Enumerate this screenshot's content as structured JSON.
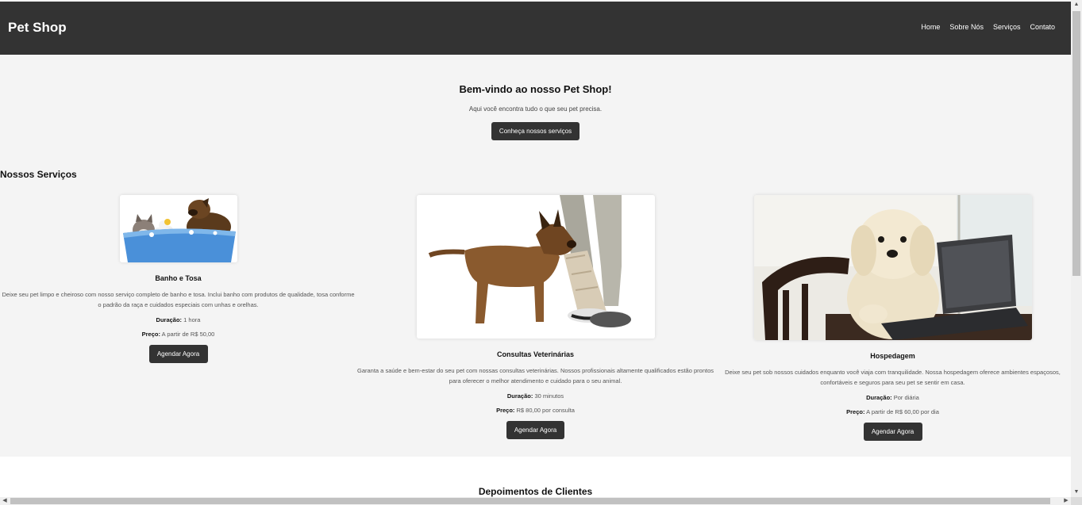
{
  "header": {
    "brand": "Pet Shop",
    "nav": [
      "Home",
      "Sobre Nós",
      "Serviços",
      "Contato"
    ]
  },
  "hero": {
    "title": "Bem-vindo ao nosso Pet Shop!",
    "subtitle": "Aqui você encontra tudo o que seu pet precisa.",
    "cta": "Conheça nossos serviços"
  },
  "services": {
    "title": "Nossos Serviços",
    "items": [
      {
        "name": "Banho e Tosa",
        "description": "Deixe seu pet limpo e cheiroso com nosso serviço completo de banho e tosa. Inclui banho com produtos de qualidade, tosa conforme o padrão da raça e cuidados especiais com unhas e orelhas.",
        "duration_label": "Duração:",
        "duration": "1 hora",
        "price_label": "Preço:",
        "price": "A partir de R$ 50,00",
        "button": "Agendar Agora"
      },
      {
        "name": "Consultas Veterinárias",
        "description": "Garanta a saúde e bem-estar do seu pet com nossas consultas veterinárias. Nossos profissionais altamente qualificados estão prontos para oferecer o melhor atendimento e cuidado para o seu animal.",
        "duration_label": "Duração:",
        "duration": "30 minutos",
        "price_label": "Preço:",
        "price": "R$ 80,00 por consulta",
        "button": "Agendar Agora"
      },
      {
        "name": "Hospedagem",
        "description": "Deixe seu pet sob nossos cuidados enquanto você viaja com tranquilidade. Nossa hospedagem oferece ambientes espaçosos, confortáveis e seguros para seu pet se sentir em casa.",
        "duration_label": "Duração:",
        "duration": "Por diária",
        "price_label": "Preço:",
        "price": "A partir de R$ 60,00 por dia",
        "button": "Agendar Agora"
      }
    ]
  },
  "testimonials": {
    "title": "Depoimentos de Clientes"
  },
  "colors": {
    "header_bg": "#333333",
    "page_bg": "#f4f4f4",
    "button_bg": "#333333"
  },
  "icons": {
    "scroll_up": "triangle-up-icon",
    "scroll_down": "triangle-down-icon",
    "scroll_left": "triangle-left-icon",
    "scroll_right": "triangle-right-icon"
  }
}
